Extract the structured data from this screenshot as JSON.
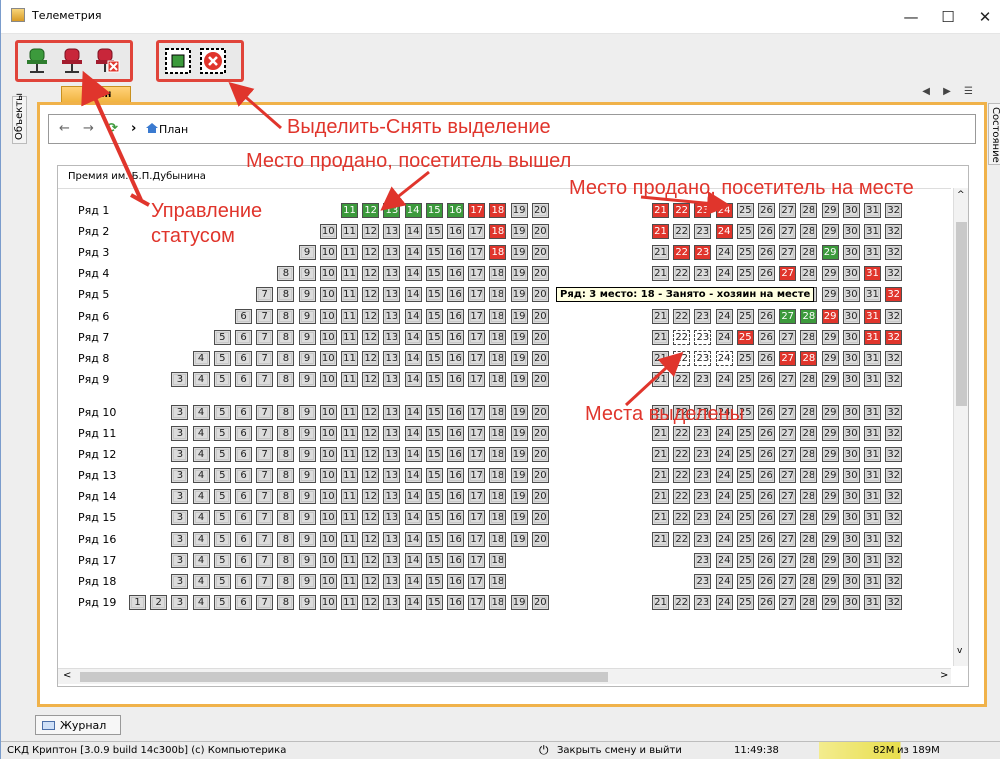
{
  "window": {
    "title": "Телеметрия",
    "minimize": "—",
    "maximize": "☐",
    "close": "✕"
  },
  "toolbar": {
    "group1": [
      "chair-green-icon",
      "chair-red-icon",
      "chair-red-cross-icon"
    ],
    "group2": [
      "select-all-icon",
      "deselect-icon"
    ]
  },
  "side": {
    "left_tab": "Объекты",
    "right_tab": "Состояние"
  },
  "tab": {
    "label": "План",
    "controls": "◀ ▶ ☰"
  },
  "nav": {
    "back": "←",
    "forward": "→",
    "refresh": "⟳",
    "sep": "›",
    "crumb": "План"
  },
  "plan": {
    "title": "Премия им. Б.П.Дубынина"
  },
  "rows": [
    {
      "label": "Ряд 1",
      "left_start": 11,
      "left_end": 20,
      "right_start": 21,
      "right_end": 32
    },
    {
      "label": "Ряд 2",
      "left_start": 10,
      "left_end": 20,
      "right_start": 21,
      "right_end": 32
    },
    {
      "label": "Ряд 3",
      "left_start": 9,
      "left_end": 20,
      "right_start": 21,
      "right_end": 32
    },
    {
      "label": "Ряд 4",
      "left_start": 8,
      "left_end": 20,
      "right_start": 21,
      "right_end": 32
    },
    {
      "label": "Ряд 5",
      "left_start": 7,
      "left_end": 20,
      "right_start": 21,
      "right_end": 32
    },
    {
      "label": "Ряд 6",
      "left_start": 6,
      "left_end": 20,
      "right_start": 21,
      "right_end": 32
    },
    {
      "label": "Ряд 7",
      "left_start": 5,
      "left_end": 20,
      "right_start": 21,
      "right_end": 32
    },
    {
      "label": "Ряд 8",
      "left_start": 4,
      "left_end": 20,
      "right_start": 21,
      "right_end": 32
    },
    {
      "label": "Ряд 9",
      "left_start": 3,
      "left_end": 20,
      "right_start": 21,
      "right_end": 32
    },
    {
      "label": "Ряд 10",
      "left_start": 3,
      "left_end": 20,
      "right_start": 21,
      "right_end": 32
    },
    {
      "label": "Ряд 11",
      "left_start": 3,
      "left_end": 20,
      "right_start": 21,
      "right_end": 32
    },
    {
      "label": "Ряд 12",
      "left_start": 3,
      "left_end": 20,
      "right_start": 21,
      "right_end": 32
    },
    {
      "label": "Ряд 13",
      "left_start": 3,
      "left_end": 20,
      "right_start": 21,
      "right_end": 32
    },
    {
      "label": "Ряд 14",
      "left_start": 3,
      "left_end": 20,
      "right_start": 21,
      "right_end": 32
    },
    {
      "label": "Ряд 15",
      "left_start": 3,
      "left_end": 20,
      "right_start": 21,
      "right_end": 32
    },
    {
      "label": "Ряд 16",
      "left_start": 3,
      "left_end": 20,
      "right_start": 21,
      "right_end": 32
    },
    {
      "label": "Ряд 17",
      "left_start": 3,
      "left_end": 18,
      "right_start": 23,
      "right_end": 32
    },
    {
      "label": "Ряд 18",
      "left_start": 3,
      "left_end": 18,
      "right_start": 23,
      "right_end": 32
    },
    {
      "label": "Ряд 19",
      "left_start": 1,
      "left_end": 20,
      "right_start": 21,
      "right_end": 32
    }
  ],
  "seat_status": {
    "green": {
      "1": [
        11,
        12,
        13,
        14,
        15,
        16
      ],
      "3": [
        29
      ],
      "6": [
        27,
        28
      ]
    },
    "red": {
      "1": [
        17,
        18,
        21,
        22,
        23,
        24
      ],
      "2": [
        18,
        21,
        24
      ],
      "3": [
        18,
        22,
        23
      ],
      "4": [
        27,
        31
      ],
      "5": [
        32
      ],
      "6": [
        29,
        31
      ],
      "7": [
        25,
        31,
        32
      ],
      "8": [
        27,
        28
      ]
    },
    "selected": {
      "7": [
        22,
        23
      ],
      "8": [
        22,
        23,
        24
      ]
    }
  },
  "tooltip": "Ряд: 3 место: 18 - Занято - хозяин на месте",
  "annotations": {
    "a1": "Выделить-Снять выделение",
    "a2": "Место продано, посетитель вышел",
    "a3": "Место продано, посетитель на месте",
    "a4": "Управление",
    "a5": "статусом",
    "a6": "Места выделены"
  },
  "bottom_tab": "Журнал",
  "status": {
    "app": "СКД Криптон [3.0.9 build 14c300b] (c) Компьютерика",
    "close_shift": "Закрыть смену и выйти",
    "time": "11:49:38",
    "memory_used": "82M",
    "memory_total": " из 189M"
  },
  "colors": {
    "green": "#3c9a3c",
    "red": "#e0352c",
    "free": "#dcdcdc",
    "accent": "#f0b24a"
  }
}
